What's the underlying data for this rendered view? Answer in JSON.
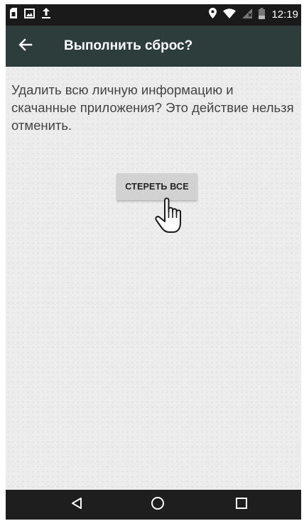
{
  "status_bar": {
    "time": "12:19",
    "left_icons": [
      "sim-card-icon",
      "image-notification-icon",
      "upload-icon"
    ],
    "right_icons": [
      "location-icon",
      "wifi-icon",
      "no-signal-icon",
      "battery-icon"
    ]
  },
  "app_bar": {
    "title": "Выполнить сброс?",
    "back_icon": "arrow-back-icon"
  },
  "content": {
    "message": "Удалить всю личную информацию и скачанные приложения? Это действие нельзя отменить.",
    "erase_button_label": "СТЕРЕТЬ ВСЕ"
  },
  "nav_bar": {
    "buttons": [
      "back-triangle-icon",
      "home-circle-icon",
      "recents-square-icon"
    ]
  },
  "colors": {
    "status_bar": "#1a1a1a",
    "app_bar": "#2d3d3c",
    "content_bg": "#ececec",
    "button_bg": "#d2d2d2",
    "nav_bar": "#1e1e1e"
  }
}
